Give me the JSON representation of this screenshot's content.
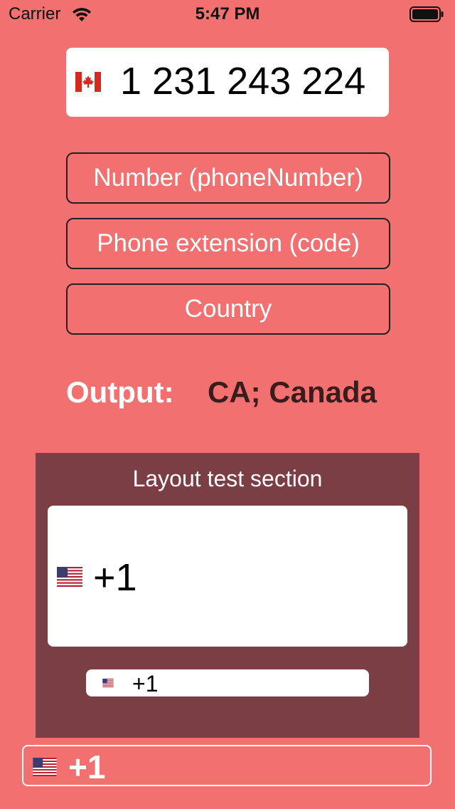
{
  "status_bar": {
    "carrier": "Carrier",
    "time": "5:47 PM",
    "icons": [
      "wifi-icon",
      "battery-icon"
    ]
  },
  "main_phone_field": {
    "flag": "canada-flag-icon",
    "value": "1 231 243 224"
  },
  "buttons": {
    "number": "Number (phoneNumber)",
    "extension": "Phone extension (code)",
    "country": "Country"
  },
  "output": {
    "label": "Output:",
    "value": "CA; Canada"
  },
  "layout_test": {
    "title": "Layout test section",
    "large_field": {
      "flag": "us-flag-icon",
      "value": "+1"
    },
    "small_field": {
      "flag": "us-flag-icon",
      "value": "+1"
    }
  },
  "bottom_field": {
    "flag": "us-flag-icon",
    "value": "+1"
  },
  "colors": {
    "background": "#f27170",
    "section_background": "#7c3e45",
    "output_value": "#3a1c1c"
  }
}
